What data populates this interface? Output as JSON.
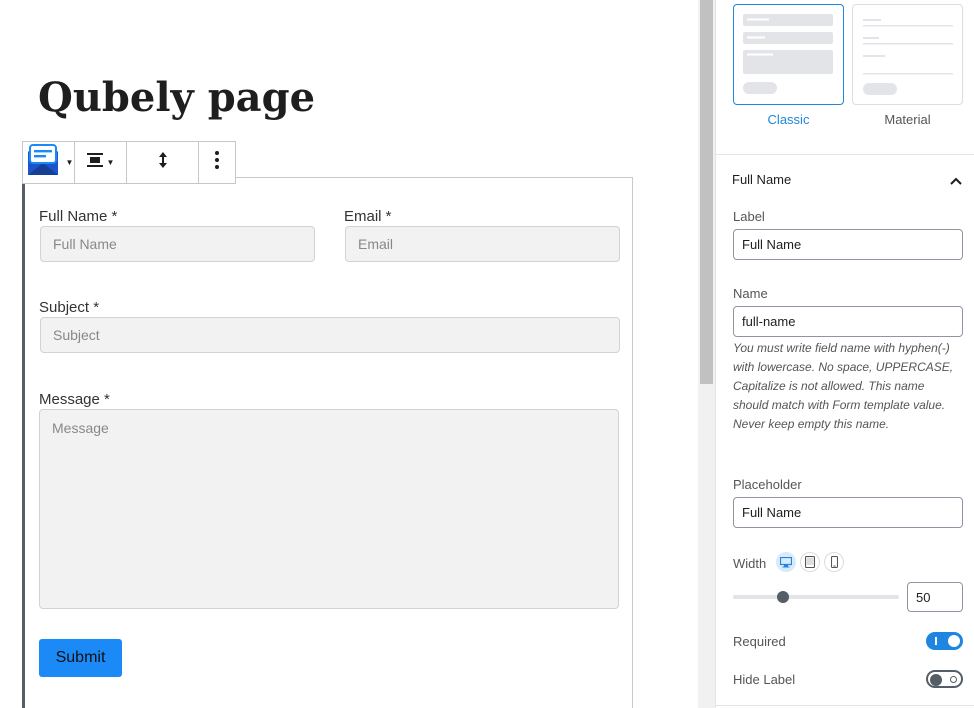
{
  "page": {
    "title": "Qubely page"
  },
  "form": {
    "fields": {
      "full_name": {
        "label": "Full Name *",
        "placeholder": "Full Name"
      },
      "email": {
        "label": "Email *",
        "placeholder": "Email"
      },
      "subject": {
        "label": "Subject *",
        "placeholder": "Subject"
      },
      "message": {
        "label": "Message *",
        "placeholder": "Message"
      }
    },
    "submit_label": "Submit"
  },
  "sidebar": {
    "layouts": [
      {
        "name": "Classic",
        "selected": true
      },
      {
        "name": "Material",
        "selected": false
      }
    ],
    "panel_title": "Full Name",
    "label_field": {
      "label": "Label",
      "value": "Full Name"
    },
    "name_field": {
      "label": "Name",
      "value": "full-name",
      "help": "You must write field name with hyphen(-) with lowercase. No space, UPPERCASE, Capitalize is not allowed. This name should match with Form template value. Never keep empty this name."
    },
    "placeholder_field": {
      "label": "Placeholder",
      "value": "Full Name"
    },
    "width": {
      "label": "Width",
      "value": "50",
      "percent": 0.3
    },
    "required": {
      "label": "Required",
      "on": true
    },
    "hide_label": {
      "label": "Hide Label",
      "on": false
    }
  },
  "colors": {
    "accent": "#1e86e0",
    "submit": "#1b8af7"
  },
  "icons": {
    "toolbar": [
      "form-block-icon",
      "align-center-icon",
      "move-arrows-icon",
      "more-vertical-icon"
    ],
    "panel_toggle": "chevron-up-icon",
    "devices": [
      "desktop-icon",
      "tablet-icon",
      "mobile-icon"
    ]
  }
}
